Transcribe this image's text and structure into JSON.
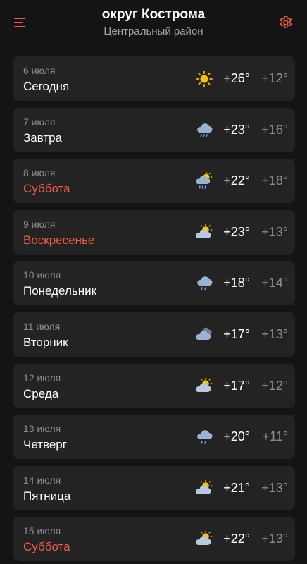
{
  "header": {
    "title": "округ Кострома",
    "subtitle": "Центральный район",
    "accent": "#f05a46",
    "menu_icon": "hamburger-menu-icon",
    "settings_icon": "gear-icon"
  },
  "forecast": [
    {
      "date": "6 июля",
      "day": "Сегодня",
      "icon": "sun",
      "t_day": "+26°",
      "t_night": "+12°",
      "weekend": false
    },
    {
      "date": "7 июля",
      "day": "Завтра",
      "icon": "cloud-rain",
      "t_day": "+23°",
      "t_night": "+16°",
      "weekend": false
    },
    {
      "date": "8 июля",
      "day": "Суббота",
      "icon": "sun-cloud-rain",
      "t_day": "+22°",
      "t_night": "+18°",
      "weekend": true
    },
    {
      "date": "9 июля",
      "day": "Воскресенье",
      "icon": "sun-cloud",
      "t_day": "+23°",
      "t_night": "+13°",
      "weekend": true
    },
    {
      "date": "10 июля",
      "day": "Понедельник",
      "icon": "cloud-light-rain",
      "t_day": "+18°",
      "t_night": "+14°",
      "weekend": false
    },
    {
      "date": "11 июля",
      "day": "Вторник",
      "icon": "cloudy",
      "t_day": "+17°",
      "t_night": "+13°",
      "weekend": false
    },
    {
      "date": "12 июля",
      "day": "Среда",
      "icon": "sun-cloud",
      "t_day": "+17°",
      "t_night": "+12°",
      "weekend": false
    },
    {
      "date": "13 июля",
      "day": "Четверг",
      "icon": "cloud-light-rain",
      "t_day": "+20°",
      "t_night": "+11°",
      "weekend": false
    },
    {
      "date": "14 июля",
      "day": "Пятница",
      "icon": "sun-cloud",
      "t_day": "+21°",
      "t_night": "+13°",
      "weekend": false
    },
    {
      "date": "15 июля",
      "day": "Суббота",
      "icon": "sun-cloud",
      "t_day": "+22°",
      "t_night": "+13°",
      "weekend": true
    }
  ]
}
